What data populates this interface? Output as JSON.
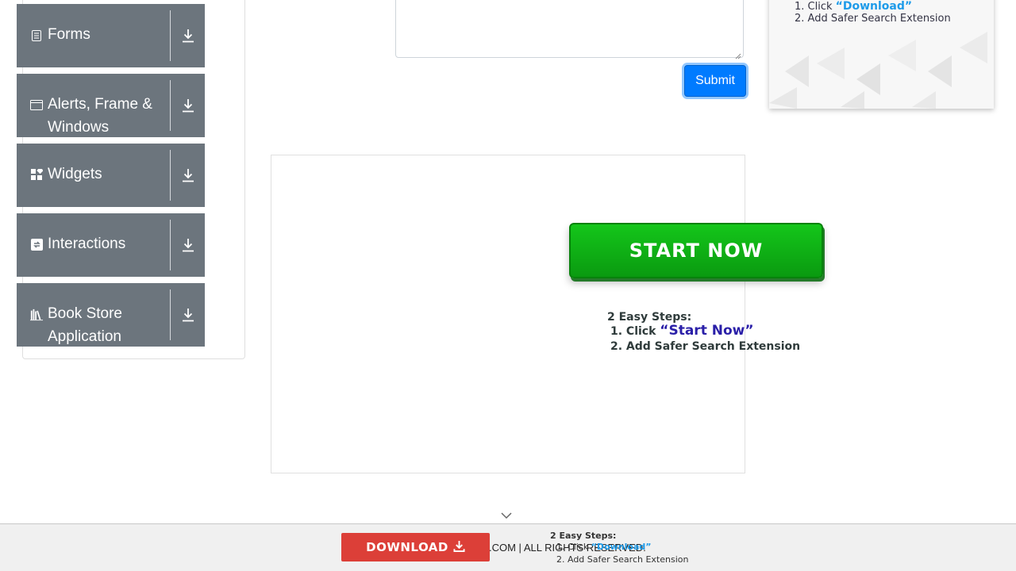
{
  "sidebar": {
    "groups": [
      {
        "label": "Forms",
        "icon": "form-icon"
      },
      {
        "label": "Alerts, Frame &\nWindows",
        "label_lines": [
          "Alerts, Frame &",
          "Windows"
        ],
        "icon": "window-icon"
      },
      {
        "label": "Widgets",
        "icon": "widgets-icon"
      },
      {
        "label": "Interactions",
        "icon": "interactions-icon"
      },
      {
        "label_lines": [
          "Book Store",
          "Application"
        ],
        "icon": "books-icon"
      }
    ],
    "download_icon": "download-icon"
  },
  "form": {
    "submit_label": "Submit"
  },
  "ad_top": {
    "step1_prefix": "1. Click",
    "step1_accent": "“Download”",
    "step2": "2. Add Safer Search Extension"
  },
  "ad_main": {
    "cta_label": "START NOW",
    "steps_title": "2 Easy Steps:",
    "step1_prefix": "1. Click",
    "step1_accent": "“Start Now”",
    "step2": "2. Add Safer Search Extension"
  },
  "footer": {
    "download_label": "DOWNLOAD",
    "copyright": ".COM | ALL RIGHTS RESERVED.",
    "steps_title": "2 Easy Steps:",
    "step1_prefix": "1. Click",
    "step1_accent": "“Download”",
    "step2": "2. Add Safer Search Extension"
  },
  "colors": {
    "card_bg": "#6c757d",
    "submit_bg": "#007bff",
    "start_green": "#14c61a",
    "download_red": "#dc3f38",
    "accent_blue": "#1e9be9"
  }
}
